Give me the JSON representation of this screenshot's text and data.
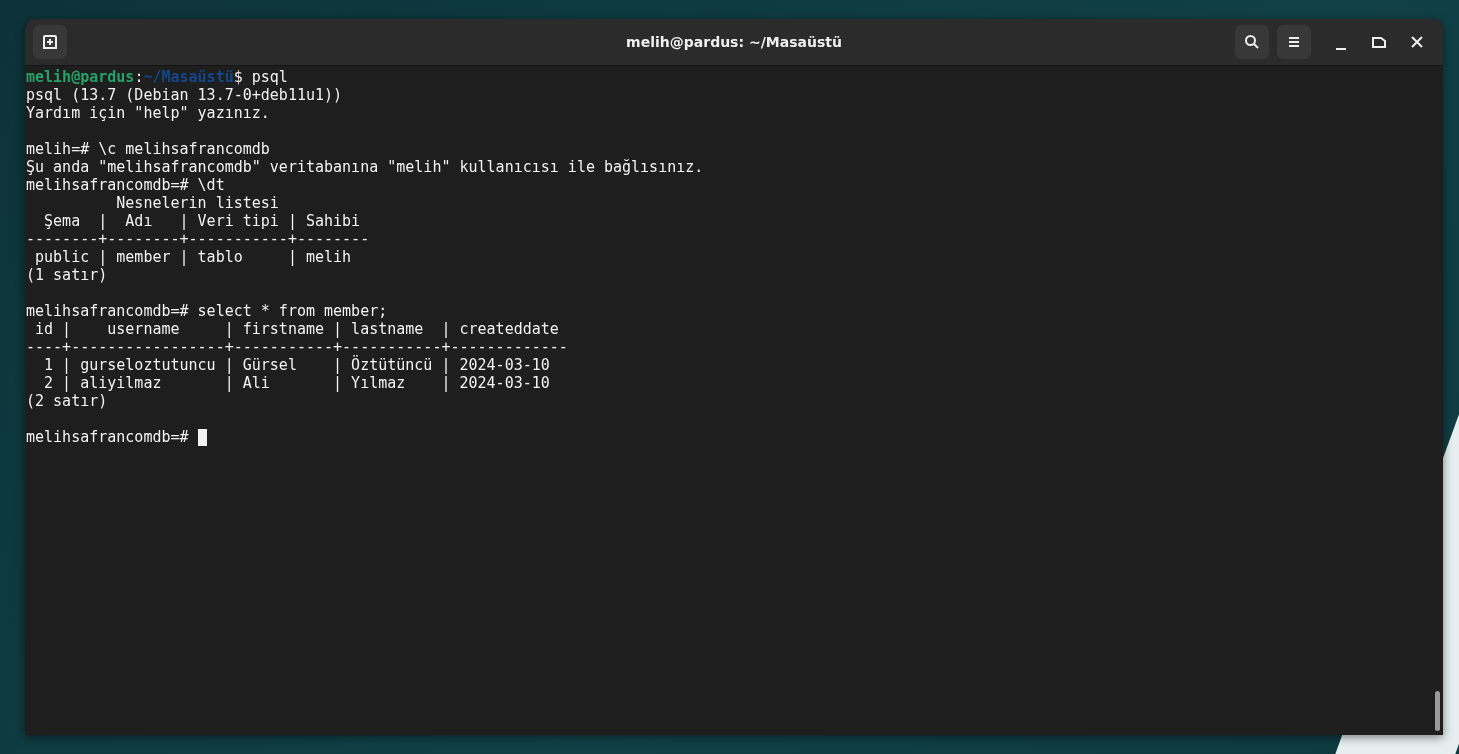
{
  "window": {
    "title": "melih@pardus: ~/Masaüstü"
  },
  "terminal": {
    "lines": [
      {
        "kind": "text",
        "segments": [
          {
            "kind": "user",
            "text": "melih@pardus"
          },
          {
            "kind": "plain",
            "text": ":"
          },
          {
            "kind": "path",
            "text": "~/Masaüstü"
          },
          {
            "kind": "plain",
            "text": "$ psql"
          }
        ]
      },
      {
        "kind": "text",
        "segments": [
          {
            "kind": "plain",
            "text": "psql (13.7 (Debian 13.7-0+deb11u1))"
          }
        ]
      },
      {
        "kind": "text",
        "segments": [
          {
            "kind": "plain",
            "text": "Yardım için \"help\" yazınız."
          }
        ]
      },
      {
        "kind": "blank"
      },
      {
        "kind": "text",
        "segments": [
          {
            "kind": "plain",
            "text": "melih=# \\c melihsafrancomdb"
          }
        ]
      },
      {
        "kind": "text",
        "segments": [
          {
            "kind": "plain",
            "text": "Şu anda \"melihsafrancomdb\" veritabanına \"melih\" kullanıcısı ile bağlısınız."
          }
        ]
      },
      {
        "kind": "text",
        "segments": [
          {
            "kind": "plain",
            "text": "melihsafrancomdb=# \\dt"
          }
        ]
      },
      {
        "kind": "text",
        "segments": [
          {
            "kind": "plain",
            "text": "          Nesnelerin listesi"
          }
        ]
      },
      {
        "kind": "text",
        "segments": [
          {
            "kind": "plain",
            "text": "  Şema  |  Adı   | Veri tipi | Sahibi"
          }
        ]
      },
      {
        "kind": "text",
        "segments": [
          {
            "kind": "plain",
            "text": "--------+--------+-----------+--------"
          }
        ]
      },
      {
        "kind": "text",
        "segments": [
          {
            "kind": "plain",
            "text": " public | member | tablo     | melih"
          }
        ]
      },
      {
        "kind": "text",
        "segments": [
          {
            "kind": "plain",
            "text": "(1 satır)"
          }
        ]
      },
      {
        "kind": "blank"
      },
      {
        "kind": "text",
        "segments": [
          {
            "kind": "plain",
            "text": "melihsafrancomdb=# select * from member;"
          }
        ]
      },
      {
        "kind": "text",
        "segments": [
          {
            "kind": "plain",
            "text": " id |    username     | firstname | lastname  | createddate"
          }
        ]
      },
      {
        "kind": "text",
        "segments": [
          {
            "kind": "plain",
            "text": "----+-----------------+-----------+-----------+-------------"
          }
        ]
      },
      {
        "kind": "text",
        "segments": [
          {
            "kind": "plain",
            "text": "  1 | gurseloztutuncu | Gürsel    | Öztütüncü | 2024-03-10"
          }
        ]
      },
      {
        "kind": "text",
        "segments": [
          {
            "kind": "plain",
            "text": "  2 | aliyilmaz       | Ali       | Yılmaz    | 2024-03-10"
          }
        ]
      },
      {
        "kind": "text",
        "segments": [
          {
            "kind": "plain",
            "text": "(2 satır)"
          }
        ]
      },
      {
        "kind": "blank"
      },
      {
        "kind": "prompt",
        "segments": [
          {
            "kind": "plain",
            "text": "melihsafrancomdb=# "
          }
        ],
        "cursor": true
      }
    ]
  }
}
